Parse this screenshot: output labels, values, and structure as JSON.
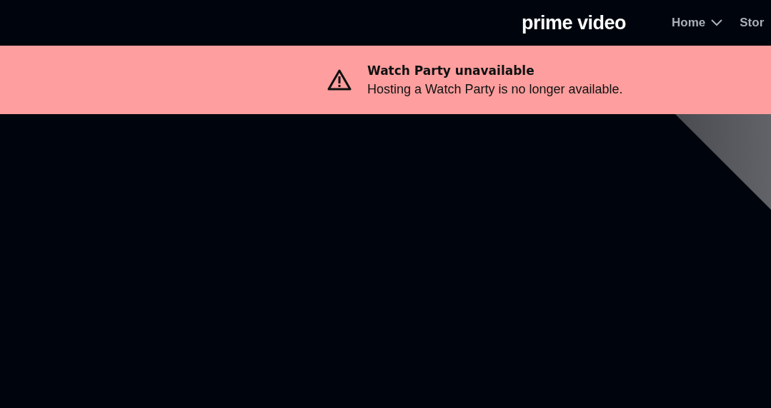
{
  "header": {
    "logo": "prime video",
    "nav": [
      {
        "label": "Home",
        "has_menu": true
      },
      {
        "label": "Stor",
        "has_menu": false
      }
    ]
  },
  "alert": {
    "kind": "warning",
    "title": "Watch Party unavailable",
    "message": "Hosting a Watch Party is no longer available."
  }
}
